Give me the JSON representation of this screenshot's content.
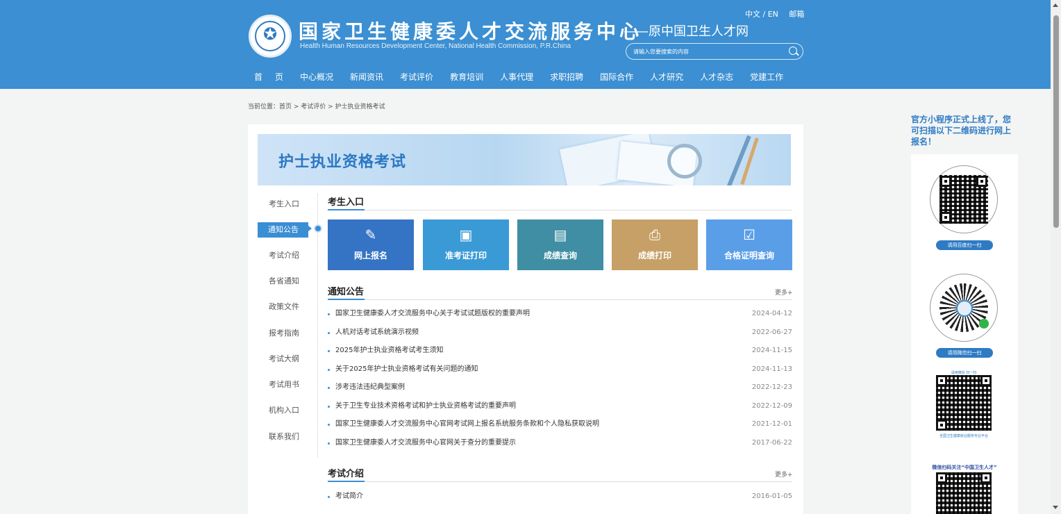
{
  "header": {
    "title_cn": "国家卫生健康委人才交流服务中心",
    "title_en": "Health Human Resources Development Center, National Health Commission, P.R.China",
    "subtitle": "——原中国卫生人才网",
    "lang": "中文 / EN",
    "mail": "邮箱",
    "search_placeholder": "请输入您要搜索的内容"
  },
  "nav": [
    "首页",
    "中心概况",
    "新闻资讯",
    "考试评价",
    "教育培训",
    "人事代理",
    "求职招聘",
    "国际合作",
    "人才研究",
    "人才杂志",
    "党建工作"
  ],
  "breadcrumb": "当前位置：首页 > 考试评价 > 护士执业资格考试",
  "banner_title": "护士执业资格考试",
  "side_menu": [
    "考生入口",
    "通知公告",
    "考试介绍",
    "各省通知",
    "政策文件",
    "报考指南",
    "考试大纲",
    "考试用书",
    "机构入口",
    "联系我们"
  ],
  "entry": {
    "title": "考生入口",
    "tiles": [
      {
        "label": "网上报名",
        "color": "#3574c4",
        "icon": "pen-icon"
      },
      {
        "label": "准考证打印",
        "color": "#3a9ad6",
        "icon": "id-card-icon"
      },
      {
        "label": "成绩查询",
        "color": "#3f8ea4",
        "icon": "search-doc-icon"
      },
      {
        "label": "成绩打印",
        "color": "#c6a066",
        "icon": "printer-icon"
      },
      {
        "label": "合格证明查询",
        "color": "#5a9ee8",
        "icon": "certificate-icon"
      }
    ]
  },
  "notices": {
    "title": "通知公告",
    "more": "更多+",
    "items": [
      {
        "text": "国家卫生健康委人才交流服务中心关于考试试题版权的重要声明",
        "date": "2024-04-12"
      },
      {
        "text": "人机对话考试系统演示视频",
        "date": "2022-06-27"
      },
      {
        "text": "2025年护士执业资格考试考生须知",
        "date": "2024-11-15"
      },
      {
        "text": "关于2025年护士执业资格考试有关问题的通知",
        "date": "2024-11-13"
      },
      {
        "text": "涉考违法违纪典型案例",
        "date": "2022-12-23"
      },
      {
        "text": "关于卫生专业技术资格考试和护士执业资格考试的重要声明",
        "date": "2022-12-09"
      },
      {
        "text": "国家卫生健康委人才交流服务中心官网考试网上报名系统服务条款和个人隐私获取说明",
        "date": "2021-12-01"
      },
      {
        "text": "国家卫生健康委人才交流服务中心官网关于查分的重要提示",
        "date": "2017-06-22"
      }
    ]
  },
  "intro": {
    "title": "考试介绍",
    "more": "更多+",
    "items": [
      {
        "text": "考试简介",
        "date": "2016-01-05"
      }
    ]
  },
  "promo": {
    "title": "官方小程序正式上线了，您可扫描以下二维码进行网上报名！",
    "baidu": "请用百度扫一扫",
    "wechat": "请用微信扫一扫",
    "scan_caption": "请用微信 扫一扫",
    "platform_caption": "全国卫生健康就业服务专业平台",
    "follow": "微信扫码关注“中国卫生人才”"
  }
}
